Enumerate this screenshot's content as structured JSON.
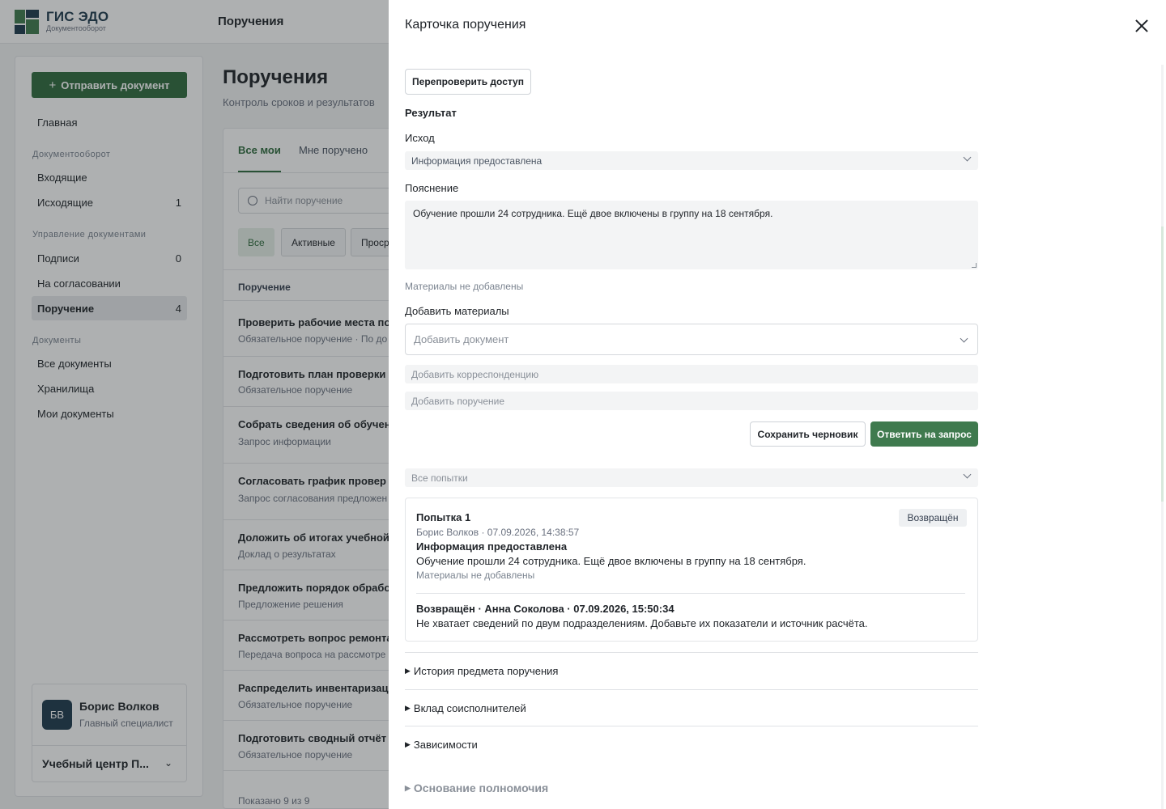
{
  "app": {
    "logo_title": "ГИС ЭДО",
    "logo_sub": "Документооборот",
    "top_section": "Поручения"
  },
  "sidebar": {
    "send_button": "Отправить документ",
    "home": "Главная",
    "groups": {
      "docflow": "Документооборот",
      "management": "Управление документами",
      "documents": "Документы"
    },
    "items": {
      "incoming": {
        "label": "Входящие",
        "count": ""
      },
      "outgoing": {
        "label": "Исходящие",
        "count": "1"
      },
      "signatures": {
        "label": "Подписи",
        "count": "0"
      },
      "approval": {
        "label": "На согласовании",
        "count": ""
      },
      "assignment": {
        "label": "Поручение",
        "count": "4"
      },
      "all_docs": {
        "label": "Все документы",
        "count": ""
      },
      "storage": {
        "label": "Хранилища",
        "count": ""
      },
      "my_docs": {
        "label": "Мои документы",
        "count": ""
      }
    },
    "user": {
      "initials": "БВ",
      "name": "Борис Волков",
      "role": "Главный специалист",
      "org": "Учебный центр П..."
    }
  },
  "main": {
    "title": "Поручения",
    "subtitle": "Контроль сроков и результатов",
    "tabs": [
      "Все мои",
      "Мне поручено"
    ],
    "search_placeholder": "Найти поручение",
    "filters": [
      "Все",
      "Активные",
      "Проср"
    ],
    "column": "Поручение",
    "rows": [
      {
        "title": "Проверить рабочие места по",
        "sub": "Обязательное поручение · По до"
      },
      {
        "title": "Подготовить план проверки",
        "sub": "Обязательное поручение"
      },
      {
        "title": "Собрать сведения об обучен",
        "sub": "Запрос информации"
      },
      {
        "title": "Согласовать график провер",
        "sub": "Запрос согласования предложен"
      },
      {
        "title": "Доложить об итогах учебной",
        "sub": "Доклад о результатах"
      },
      {
        "title": "Предложить порядок обрабо",
        "sub": "Предложение решения"
      },
      {
        "title": "Рассмотреть вопрос ремонта",
        "sub": "Передача вопроса на рассмотре"
      },
      {
        "title": "Распределить инвентаризац",
        "sub": "Обязательное поручение"
      },
      {
        "title": "Подготовить сводный отчёт",
        "sub": "Обязательное поручение"
      }
    ],
    "shown": "Показано 9 из 9"
  },
  "drawer": {
    "title": "Карточка поручения",
    "recheck_button": "Перепроверить доступ",
    "result_heading": "Результат",
    "outcome_label": "Исход",
    "outcome_value": "Информация предоставлена",
    "explanation_label": "Пояснение",
    "explanation_value": "Обучение прошли 24 сотрудника. Ещё двое включены в группу на 18 сентября.",
    "no_materials": "Материалы не добавлены",
    "add_materials_label": "Добавить материалы",
    "add_document_placeholder": "Добавить документ",
    "add_correspondence_placeholder": "Добавить корреспонденцию",
    "add_assignment_placeholder": "Добавить поручение",
    "save_draft_button": "Сохранить черновик",
    "reply_button": "Ответить на запрос",
    "attempts_filter": "Все попытки",
    "attempt": {
      "title": "Попытка 1",
      "status": "Возвращён",
      "meta": "Борис Волков · 07.09.2026, 14:38:57",
      "outcome": "Информация предоставлена",
      "text": "Обучение прошли 24 сотрудника. Ещё двое включены в группу на 18 сентября.",
      "materials": "Материалы не добавлены",
      "return_head": "Возвращён · Анна Соколова · 07.09.2026, 15:50:34",
      "return_text": "Не хватает сведений по двум подразделениям. Добавьте их показатели и источник расчёта."
    },
    "sections": [
      "История предмета поручения",
      "Вклад соисполнителей",
      "Зависимости",
      "Основание полномочия"
    ]
  },
  "colors": {
    "accent": "#2f6b3e",
    "primary_button": "#3f7a4e",
    "overlay": "rgba(31,35,40,0.36)"
  }
}
